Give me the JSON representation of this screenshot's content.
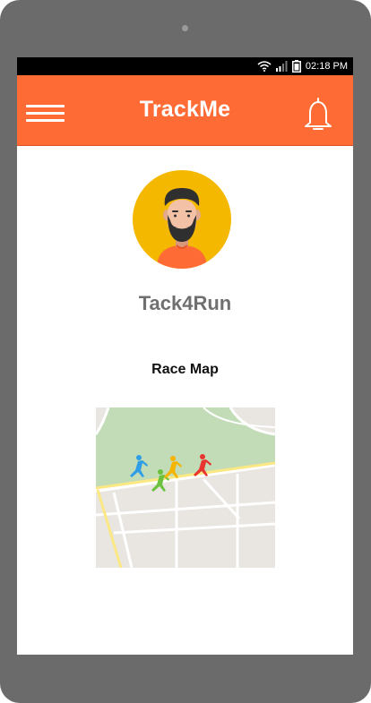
{
  "status_bar": {
    "time": "02:18 PM",
    "icons": [
      "wifi-icon",
      "signal-icon",
      "battery-icon"
    ]
  },
  "app_bar": {
    "title": "TrackMe",
    "menu_icon": "hamburger-menu-icon",
    "notification_icon": "bell-icon"
  },
  "profile": {
    "username": "Tack4Run",
    "avatar_icon": "bearded-man-avatar"
  },
  "race": {
    "section_title": "Race Map"
  },
  "colors": {
    "accent": "#ff6b35",
    "avatar_bg": "#f5b800",
    "username": "#707070",
    "device_frame": "#6b6b6b"
  }
}
